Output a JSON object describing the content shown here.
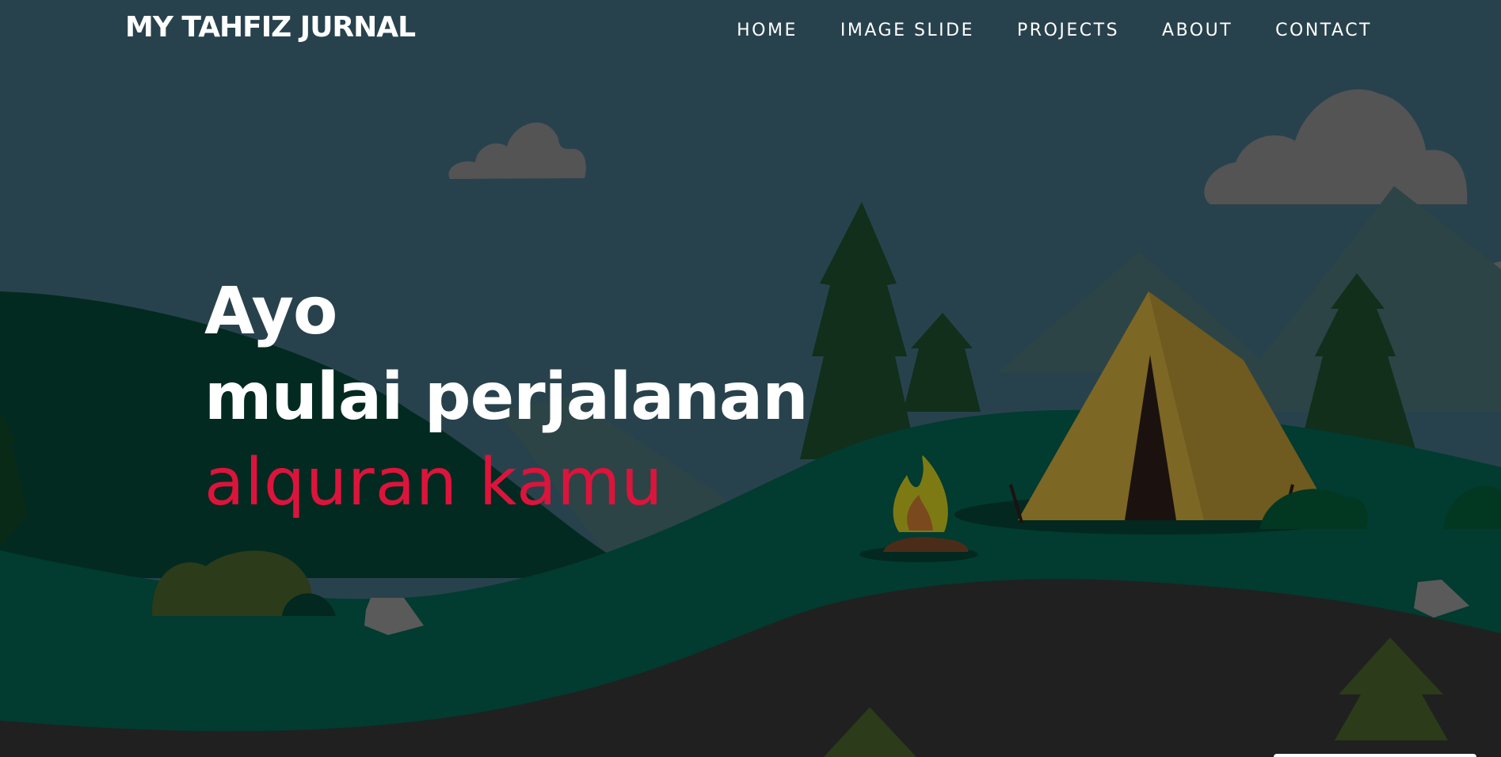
{
  "brand": {
    "title": "MY TAHFIZ JURNAL"
  },
  "nav": {
    "items": [
      {
        "label": "HOME"
      },
      {
        "label": "IMAGE SLIDE"
      },
      {
        "label": "PROJECTS"
      },
      {
        "label": "ABOUT"
      },
      {
        "label": "CONTACT"
      }
    ]
  },
  "hero": {
    "line1": "Ayo",
    "line2": "mulai perjalanan",
    "line3": "alquran kamu"
  },
  "colors": {
    "sky": "#28424d",
    "hill": "#023b30",
    "dark_hill": "#032a20",
    "road": "#202020",
    "accent": "#dc143c",
    "text": "#ffffff",
    "cloud": "#545454",
    "tent": "#7d6724",
    "tree": "#102f1a"
  },
  "icons": {
    "scene": "campsite-illustration"
  }
}
